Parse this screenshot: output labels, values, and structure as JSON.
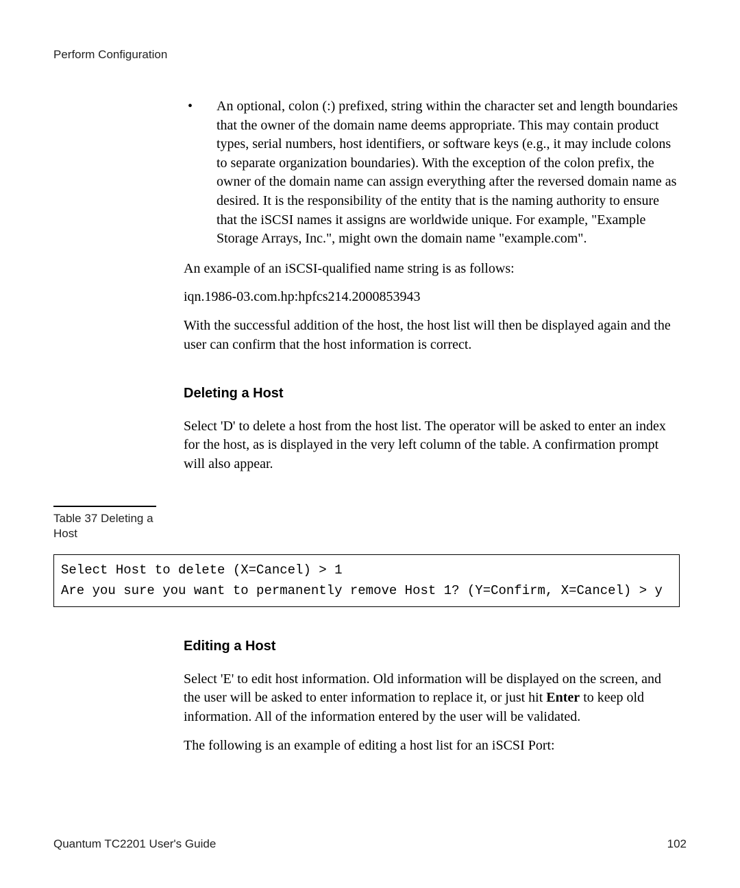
{
  "header": {
    "section_label": "Perform Configuration"
  },
  "body": {
    "bullet1": "An optional, colon (:) prefixed, string within the character set and length boundaries that the owner of the domain name deems appropriate. This may contain product types, serial numbers, host identifiers, or software keys (e.g., it may include colons to separate organization boundaries). With the exception of the colon prefix, the owner of the domain name can assign everything after the reversed domain name as desired. It is the responsibility of the entity that is the naming authority to ensure that the iSCSI names it assigns are worldwide unique. For example, \"Example Storage Arrays, Inc.\", might own the domain name \"example.com\".",
    "para_example_intro": "An example of an iSCSI-qualified name string is as follows:",
    "para_example_iqn": "iqn.1986-03.com.hp:hpfcs214.2000853943",
    "para_success": "With the successful addition of the host, the host list will then be displayed again and the user can confirm that the host information is correct.",
    "heading_delete": "Deleting a Host",
    "para_delete": "Select 'D' to delete a host from the host list. The operator will be asked to enter an index for the host, as is displayed in the very left column of the table. A confirmation prompt will also appear.",
    "table_caption": "Table 37   Deleting a Host",
    "code_line1": "Select Host to delete (X=Cancel) > 1",
    "code_line2": "Are you sure you want to permanently remove Host 1? (Y=Confirm, X=Cancel) > y",
    "heading_edit": "Editing a Host",
    "para_edit_prefix": "Select 'E' to edit host information. Old information will be displayed on the screen, and the user will be asked to enter information to replace it, or just hit ",
    "para_edit_bold": "Enter",
    "para_edit_suffix": " to keep old information. All of the information entered by the user will be validated.",
    "para_edit_followup": "The following is an example of editing a host list for an iSCSI Port:"
  },
  "footer": {
    "doc_title": "Quantum TC2201 User's Guide",
    "page_number": "102"
  }
}
